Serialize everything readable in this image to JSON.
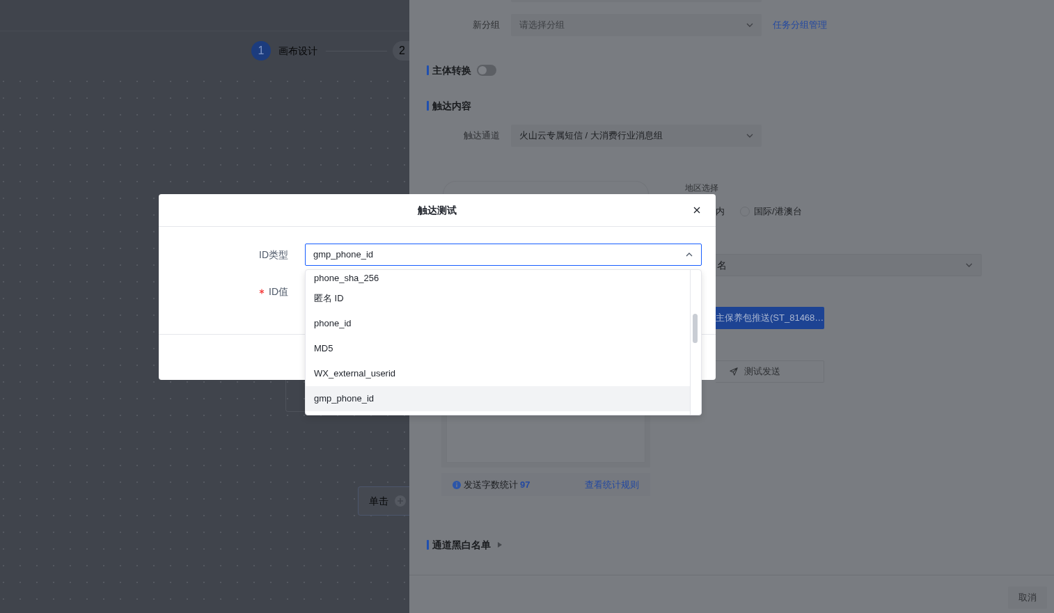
{
  "canvas": {
    "steps": [
      {
        "number": "1",
        "label": "画布设计",
        "active": true
      },
      {
        "number": "2",
        "active": false
      }
    ],
    "nodes": [
      {
        "label": "单击"
      }
    ]
  },
  "drawer": {
    "group_field": {
      "label": "新分组",
      "placeholder": "请选择分组",
      "link": "任务分组管理"
    },
    "subject_switch": {
      "title": "主体转换",
      "on": false
    },
    "content_section": {
      "title": "触达内容",
      "channel": {
        "label": "触达通道",
        "value": "火山云专属短信 / 大消费行业消息组"
      },
      "char_count": {
        "label": "发送字数统计",
        "count": "97",
        "link": "查看统计规则"
      },
      "region": {
        "label": "地区选择",
        "options": [
          {
            "kind": "text",
            "label": "内"
          },
          {
            "kind": "radio",
            "label": "国际/港澳台",
            "checked": false
          }
        ]
      },
      "signature": {
        "value": "名"
      },
      "template": {
        "value": "主保养包推送(ST_81468…"
      },
      "test_button": {
        "label": "测试发送"
      }
    },
    "blacklist_section": {
      "title": "通道黑白名单",
      "expanded": false
    },
    "footer": {
      "cancel_button": "取消"
    }
  },
  "modal": {
    "title": "触达测试",
    "fields": [
      {
        "label": "ID类型",
        "required": false,
        "value": "gmp_phone_id",
        "open": true,
        "options": [
          {
            "label": "phone_sha_256",
            "selected": false
          },
          {
            "label": "匿名 ID",
            "selected": false
          },
          {
            "label": "phone_id",
            "selected": false
          },
          {
            "label": "MD5",
            "selected": false
          },
          {
            "label": "WX_external_userid",
            "selected": false
          },
          {
            "label": "gmp_phone_id",
            "selected": true
          }
        ]
      },
      {
        "label": "ID值",
        "required": true
      }
    ]
  }
}
